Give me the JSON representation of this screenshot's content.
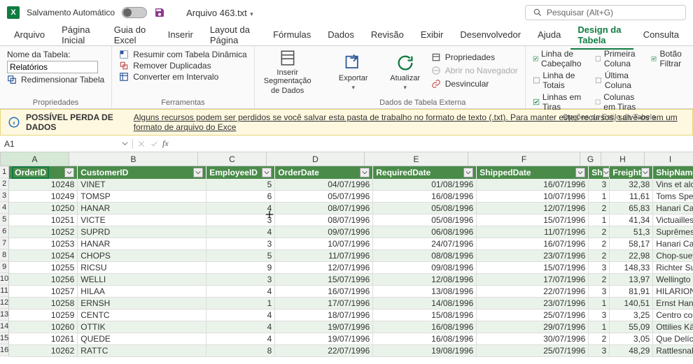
{
  "titlebar": {
    "autosave": "Salvamento Automático",
    "filename": "Arquivo 463.txt",
    "search_placeholder": "Pesquisar (Alt+G)"
  },
  "tabs": [
    "Arquivo",
    "Página Inicial",
    "Guia do Excel",
    "Inserir",
    "Layout da Página",
    "Fórmulas",
    "Dados",
    "Revisão",
    "Exibir",
    "Desenvolvedor",
    "Ajuda",
    "Design da Tabela",
    "Consulta"
  ],
  "active_tab": "Design da Tabela",
  "ribbon": {
    "props": {
      "name_label": "Nome da Tabela:",
      "name_value": "Relatórios",
      "resize": "Redimensionar Tabela",
      "group": "Propriedades"
    },
    "tools": {
      "pivot": "Resumir com Tabela Dinâmica",
      "dup": "Remover Duplicadas",
      "range": "Converter em Intervalo",
      "group": "Ferramentas"
    },
    "slicer": {
      "line1": "Inserir Segmentação",
      "line2": "de Dados"
    },
    "export": {
      "label": "Exportar"
    },
    "refresh": {
      "label": "Atualizar"
    },
    "ext": {
      "props": "Propriedades",
      "browser": "Abrir no Navegador",
      "unlink": "Desvincular",
      "group": "Dados de Tabela Externa"
    },
    "styleopts": {
      "header": "Linha de Cabeçalho",
      "totals": "Linha de Totais",
      "banded_rows": "Linhas em Tiras",
      "first": "Primeira Coluna",
      "last": "Última Coluna",
      "banded_cols": "Colunas em Tiras",
      "filter": "Botão Filtrar",
      "group": "Opções de Estilo de Tabela"
    }
  },
  "warning": {
    "bold": "POSSÍVEL PERDA DE DADOS",
    "text": "Alguns recursos podem ser perdidos se você salvar esta pasta de trabalho no formato de texto (.txt). Para manter estes recursos, salve-os em um formato de arquivo do Exce"
  },
  "namebox": "A1",
  "col_letters": [
    "A",
    "B",
    "C",
    "D",
    "E",
    "F",
    "G",
    "H",
    "I"
  ],
  "table_headers": [
    "OrderID",
    "CustomerID",
    "EmployeeID",
    "OrderDate",
    "RequiredDate",
    "ShippedDate",
    "Sh",
    "Freight",
    "ShipName"
  ],
  "rows": [
    {
      "n": 1
    },
    {
      "n": 2,
      "A": "10248",
      "B": "VINET",
      "C": "5",
      "D": "04/07/1996",
      "E": "01/08/1996",
      "F": "16/07/1996",
      "G": "3",
      "H": "32,38",
      "I": "Vins et alc"
    },
    {
      "n": 3,
      "A": "10249",
      "B": "TOMSP",
      "C": "6",
      "D": "05/07/1996",
      "E": "16/08/1996",
      "F": "10/07/1996",
      "G": "1",
      "H": "11,61",
      "I": "Toms Spez"
    },
    {
      "n": 4,
      "A": "10250",
      "B": "HANAR",
      "C": "4",
      "D": "08/07/1996",
      "E": "05/08/1996",
      "F": "12/07/1996",
      "G": "2",
      "H": "65,83",
      "I": "Hanari Car"
    },
    {
      "n": 5,
      "A": "10251",
      "B": "VICTE",
      "C": "3",
      "D": "08/07/1996",
      "E": "05/08/1996",
      "F": "15/07/1996",
      "G": "1",
      "H": "41,34",
      "I": "Victuailles"
    },
    {
      "n": 6,
      "A": "10252",
      "B": "SUPRD",
      "C": "4",
      "D": "09/07/1996",
      "E": "06/08/1996",
      "F": "11/07/1996",
      "G": "2",
      "H": "51,3",
      "I": "Suprêmes"
    },
    {
      "n": 7,
      "A": "10253",
      "B": "HANAR",
      "C": "3",
      "D": "10/07/1996",
      "E": "24/07/1996",
      "F": "16/07/1996",
      "G": "2",
      "H": "58,17",
      "I": "Hanari Car"
    },
    {
      "n": 8,
      "A": "10254",
      "B": "CHOPS",
      "C": "5",
      "D": "11/07/1996",
      "E": "08/08/1996",
      "F": "23/07/1996",
      "G": "2",
      "H": "22,98",
      "I": "Chop-suey"
    },
    {
      "n": 9,
      "A": "10255",
      "B": "RICSU",
      "C": "9",
      "D": "12/07/1996",
      "E": "09/08/1996",
      "F": "15/07/1996",
      "G": "3",
      "H": "148,33",
      "I": "Richter Su"
    },
    {
      "n": 10,
      "A": "10256",
      "B": "WELLI",
      "C": "3",
      "D": "15/07/1996",
      "E": "12/08/1996",
      "F": "17/07/1996",
      "G": "2",
      "H": "13,97",
      "I": "Wellingto"
    },
    {
      "n": 11,
      "A": "10257",
      "B": "HILAA",
      "C": "4",
      "D": "16/07/1996",
      "E": "13/08/1996",
      "F": "22/07/1996",
      "G": "3",
      "H": "81,91",
      "I": "HILARION-"
    },
    {
      "n": 12,
      "A": "10258",
      "B": "ERNSH",
      "C": "1",
      "D": "17/07/1996",
      "E": "14/08/1996",
      "F": "23/07/1996",
      "G": "1",
      "H": "140,51",
      "I": "Ernst Hanc"
    },
    {
      "n": 13,
      "A": "10259",
      "B": "CENTC",
      "C": "4",
      "D": "18/07/1996",
      "E": "15/08/1996",
      "F": "25/07/1996",
      "G": "3",
      "H": "3,25",
      "I": "Centro cor"
    },
    {
      "n": 14,
      "A": "10260",
      "B": "OTTIK",
      "C": "4",
      "D": "19/07/1996",
      "E": "16/08/1996",
      "F": "29/07/1996",
      "G": "1",
      "H": "55,09",
      "I": "Ottilies Kä"
    },
    {
      "n": 15,
      "A": "10261",
      "B": "QUEDE",
      "C": "4",
      "D": "19/07/1996",
      "E": "16/08/1996",
      "F": "30/07/1996",
      "G": "2",
      "H": "3,05",
      "I": "Que Delíci"
    },
    {
      "n": 16,
      "A": "10262",
      "B": "RATTC",
      "C": "8",
      "D": "22/07/1996",
      "E": "19/08/1996",
      "F": "25/07/1996",
      "G": "3",
      "H": "48,29",
      "I": "Rattlesnak"
    }
  ]
}
